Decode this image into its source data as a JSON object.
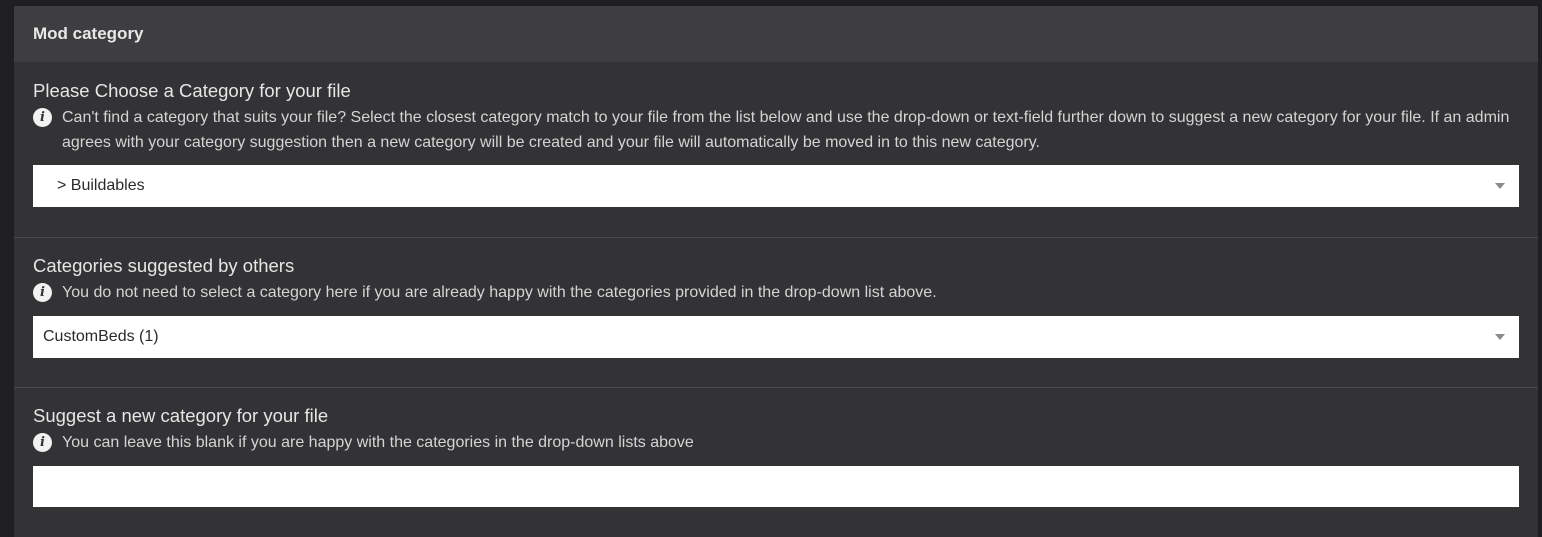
{
  "panel": {
    "title": "Mod category"
  },
  "category_section": {
    "title": "Please Choose a Category for your file",
    "info": "Can't find a category that suits your file? Select the closest category match to your file from the list below and use the drop-down or text-field further down to suggest a new category for your file. If an admin agrees with your category suggestion then a new category will be created and your file will automatically be moved in to this new category.",
    "selected": "> Buildables"
  },
  "suggested_section": {
    "title": "Categories suggested by others",
    "info": "You do not need to select a category here if you are already happy with the categories provided in the drop-down list above.",
    "selected": "CustomBeds (1)"
  },
  "new_category_section": {
    "title": "Suggest a new category for your file",
    "info": "You can leave this blank if you are happy with the categories in the drop-down lists above",
    "value": ""
  },
  "icons": {
    "info": "info-icon",
    "dropdown": "caret-down-icon"
  },
  "colors": {
    "panel_bg": "#333336",
    "header_bg": "#3e3e41",
    "input_bg": "#ffffff"
  }
}
